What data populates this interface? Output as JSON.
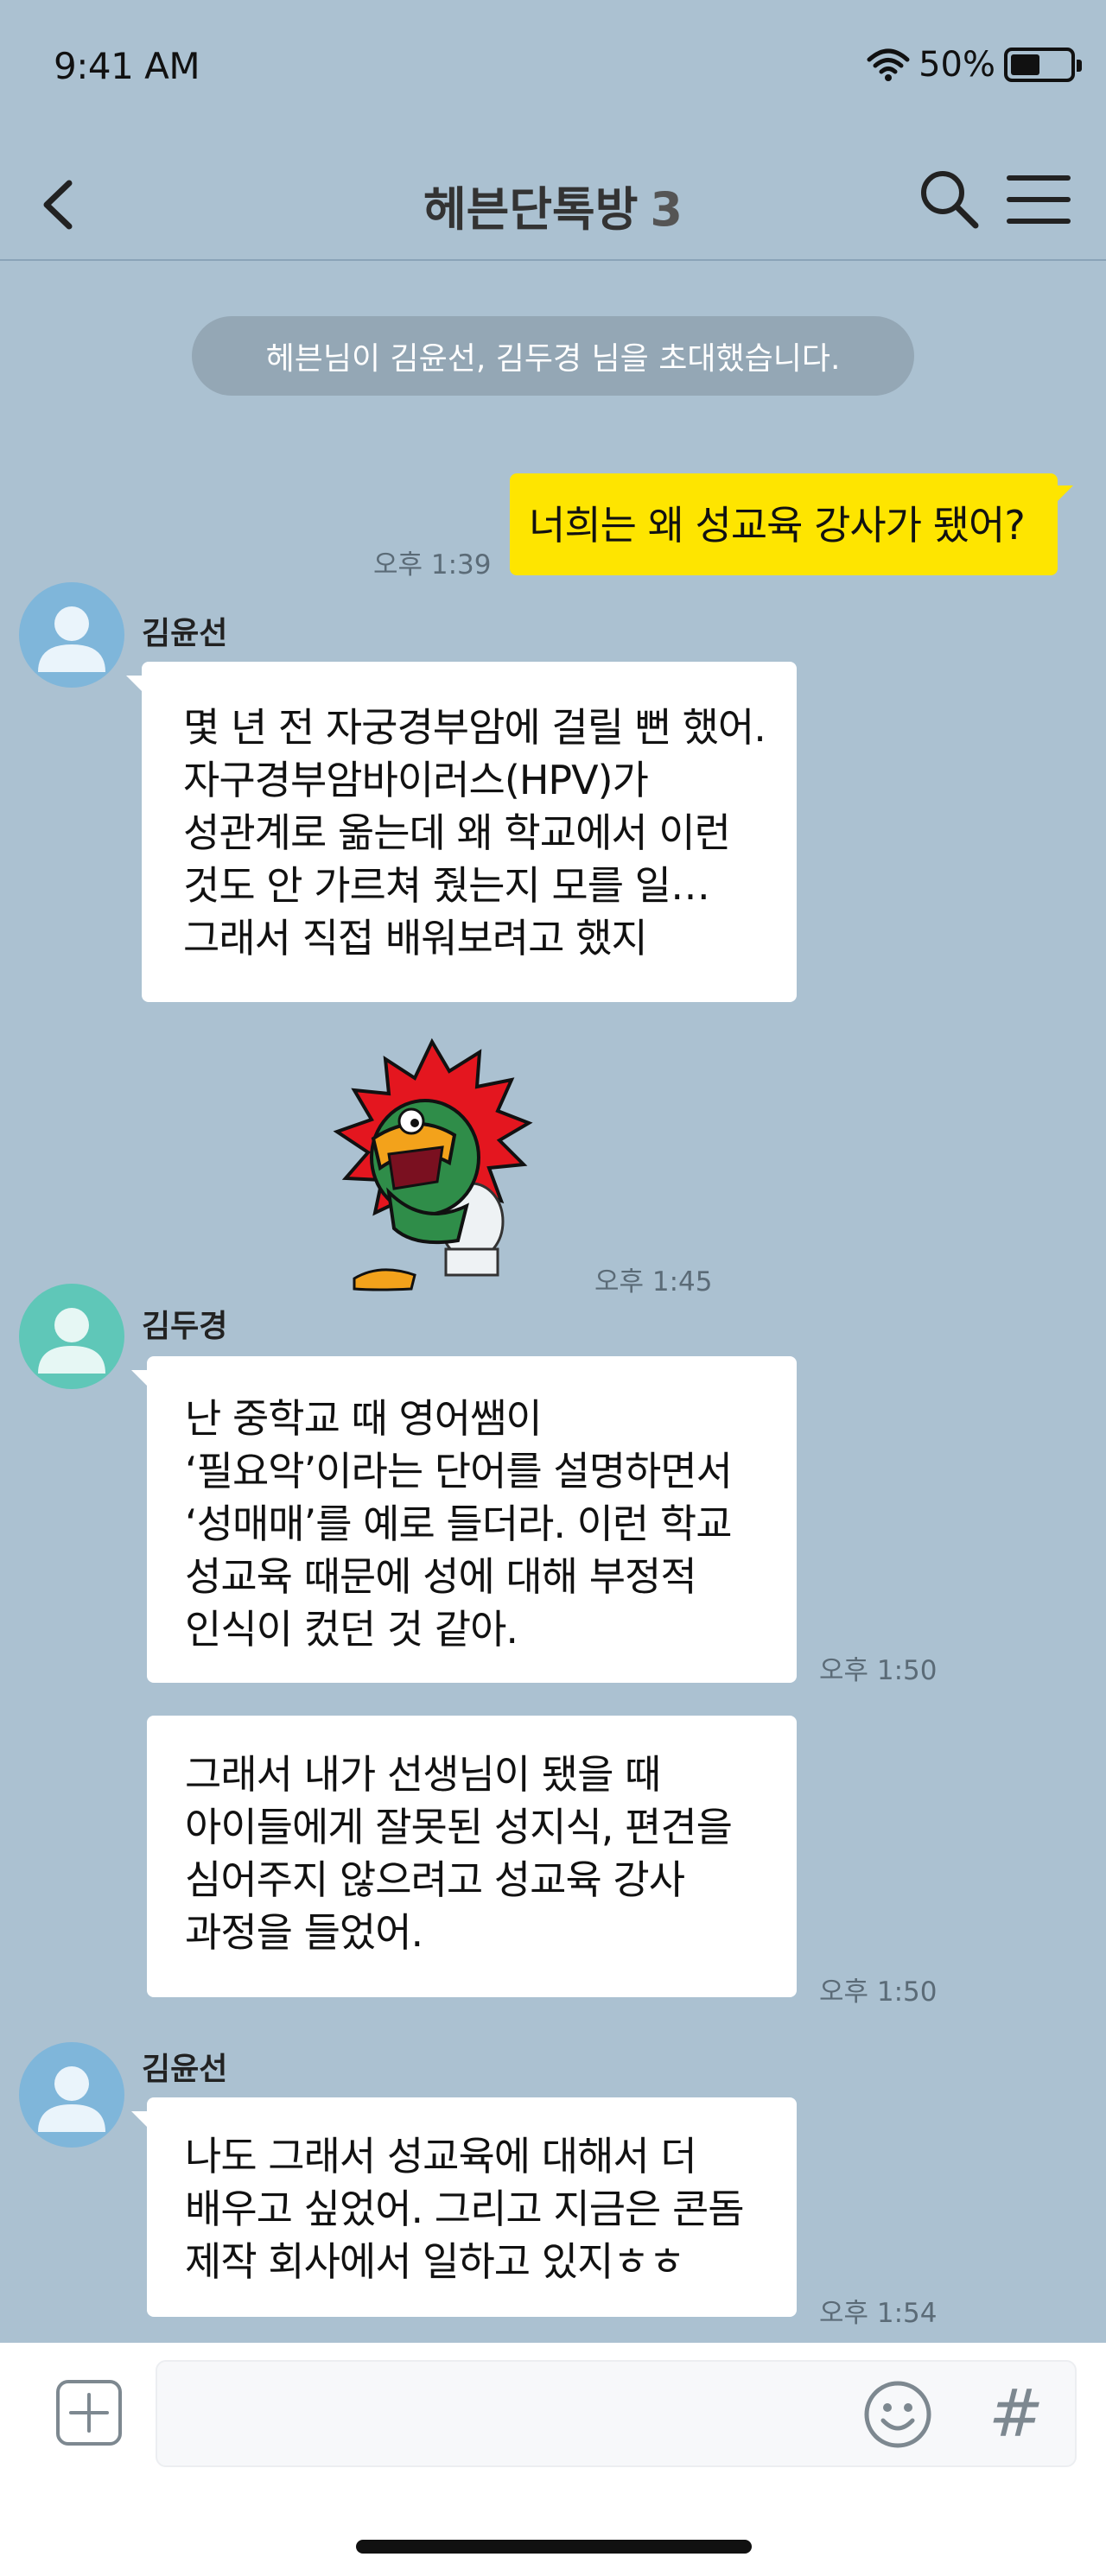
{
  "status": {
    "time": "9:41 AM",
    "battery": "50%",
    "battery_level": 0.5
  },
  "header": {
    "title": "헤븐단톡방",
    "member_count": "3"
  },
  "system_message": "헤븐님이 김윤선, 김두경 님을 초대했습니다.",
  "messages": [
    {
      "text": "너희는 왜 성교육 강사가 됐어?",
      "time": "오후 1:39"
    },
    {
      "sender": "김윤선",
      "text": "몇 년 전 자궁경부암에 걸릴 뻔 했어.\n자구경부암바이러스(HPV)가\n성관계로 옮는데 왜 학교에서 이런\n것도 안 가르쳐 줬는지 모를 일…\n그래서 직접 배워보려고 했지"
    },
    {
      "sticker": "angry-crocodile-on-toilet",
      "time": "오후 1:45"
    },
    {
      "sender": "김두경",
      "text": "난 중학교 때 영어쌤이\n‘필요악’이라는 단어를 설명하면서\n‘성매매’를 예로 들더라. 이런 학교\n성교육 때문에 성에 대해 부정적\n인식이 컸던 것 같아.",
      "time": "오후 1:50"
    },
    {
      "text": "그래서 내가 선생님이 됐을 때\n아이들에게 잘못된 성지식, 편견을\n심어주지 않으려고 성교육 강사\n과정을 들었어.",
      "time": "오후 1:50"
    },
    {
      "sender": "김윤선",
      "text": "나도 그래서 성교육에 대해서 더\n배우고 싶었어. 그리고 지금은 콘돔\n제작 회사에서 일하고 있지ㅎㅎ",
      "time": "오후 1:54"
    }
  ],
  "input": {
    "hash": "#"
  },
  "colors": {
    "background": "#abc1d1",
    "my_bubble": "#fee500",
    "other_bubble": "#ffffff",
    "avatar_blue": "#7fb6da",
    "avatar_teal": "#5fc7b8"
  }
}
